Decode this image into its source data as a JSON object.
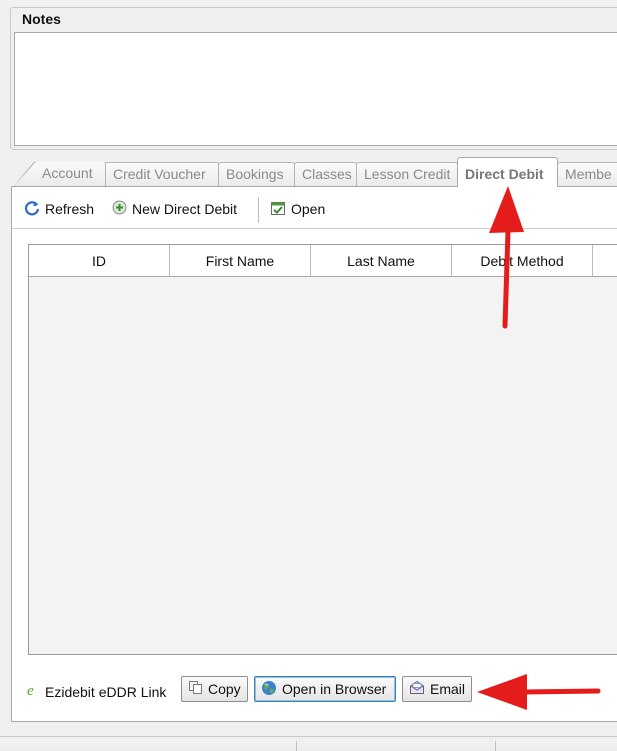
{
  "notes": {
    "label": "Notes",
    "value": ""
  },
  "tabs": [
    {
      "label": "Account"
    },
    {
      "label": "Credit Voucher"
    },
    {
      "label": "Bookings"
    },
    {
      "label": "Classes"
    },
    {
      "label": "Lesson Credit"
    },
    {
      "label": "Direct Debit",
      "active": true
    },
    {
      "label": "Membe"
    }
  ],
  "toolbar": {
    "refresh_label": "Refresh",
    "new_label": "New Direct Debit",
    "open_label": "Open"
  },
  "grid": {
    "columns": [
      "ID",
      "First Name",
      "Last Name",
      "Debit Method"
    ],
    "rows": []
  },
  "bottom": {
    "ezidebit_label": "Ezidebit eDDR Link",
    "copy_label": "Copy",
    "open_browser_label": "Open in Browser",
    "email_label": "Email"
  },
  "colors": {
    "annotation_arrow": "#e51c1c",
    "active_tab_text": "#777777",
    "ezidebit_icon": "#4caf2a"
  },
  "icons": {
    "refresh": "refresh-icon",
    "new": "add-circle-icon",
    "open": "open-document-icon",
    "ezidebit": "ezidebit-e-icon",
    "copy": "copy-icon",
    "browser": "globe-icon",
    "email": "envelope-icon"
  }
}
